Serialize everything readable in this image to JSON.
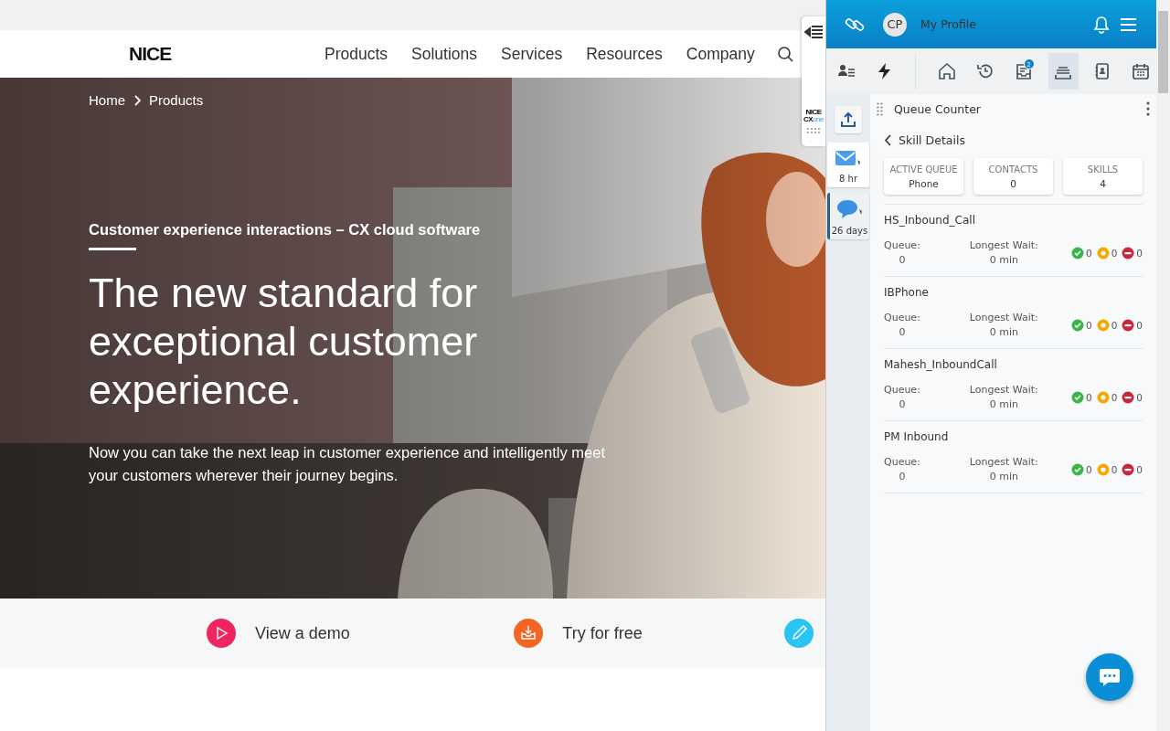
{
  "site": {
    "logo": "NICE",
    "nav": [
      "Products",
      "Solutions",
      "Services",
      "Resources",
      "Company"
    ],
    "breadcrumb": [
      "Home",
      "Products"
    ],
    "hero": {
      "eyebrow": "Customer experience interactions – CX cloud software",
      "title": "The new standard for exceptional customer experience.",
      "body": "Now you can take the next leap in customer experience and intelligently meet your customers wherever their journey begins."
    },
    "actions": [
      {
        "kind": "play",
        "label": "View a demo",
        "color": "#f0245e"
      },
      {
        "kind": "download",
        "label": "Try for free",
        "color": "#f26522"
      },
      {
        "kind": "pencil",
        "color": "#27c4f4"
      }
    ]
  },
  "side_widget": {
    "logo_top": "NICE",
    "logo_bottom": "CX",
    "logo_suffix": "one"
  },
  "agent": {
    "avatar": "CP",
    "profile": "My Profile",
    "toolbar": [
      {
        "kind": "contacts",
        "selected": false
      },
      {
        "kind": "bolt",
        "selected": false
      },
      {
        "kind": "home",
        "selected": false
      },
      {
        "kind": "history",
        "selected": false
      },
      {
        "kind": "inbox",
        "selected": false,
        "badge": "2"
      },
      {
        "kind": "queue",
        "selected": true
      },
      {
        "kind": "directory",
        "selected": false
      },
      {
        "kind": "calendar",
        "selected": false
      }
    ],
    "rail": [
      {
        "kind": "upload",
        "selected": false
      },
      {
        "kind": "email",
        "time": "8 hr",
        "selected": false
      },
      {
        "kind": "chat",
        "time": "26 days",
        "selected": true
      }
    ],
    "widget_title": "Queue Counter",
    "back": "Skill Details",
    "summary": [
      {
        "label": "ACTIVE QUEUE",
        "value": "Phone"
      },
      {
        "label": "CONTACTS",
        "value": "0"
      },
      {
        "label": "SKILLS",
        "value": "4"
      }
    ],
    "skills": [
      {
        "name": "HS_Inbound_Call",
        "queue_label": "Queue:",
        "queue": "0",
        "wait_label": "Longest Wait:",
        "wait": "0 min",
        "counts": [
          {
            "kind": "available",
            "color": "#3bb54a",
            "value": "0"
          },
          {
            "kind": "pending",
            "color": "#f7a700",
            "value": "0"
          },
          {
            "kind": "blocked",
            "color": "#c8283c",
            "value": "0"
          }
        ]
      },
      {
        "name": "IBPhone",
        "queue_label": "Queue:",
        "queue": "0",
        "wait_label": "Longest Wait:",
        "wait": "0 min",
        "counts": [
          {
            "kind": "available",
            "color": "#3bb54a",
            "value": "0"
          },
          {
            "kind": "pending",
            "color": "#f7a700",
            "value": "0"
          },
          {
            "kind": "blocked",
            "color": "#c8283c",
            "value": "0"
          }
        ]
      },
      {
        "name": "Mahesh_InboundCall",
        "queue_label": "Queue:",
        "queue": "0",
        "wait_label": "Longest Wait:",
        "wait": "0 min",
        "counts": [
          {
            "kind": "available",
            "color": "#3bb54a",
            "value": "0"
          },
          {
            "kind": "pending",
            "color": "#f7a700",
            "value": "0"
          },
          {
            "kind": "blocked",
            "color": "#c8283c",
            "value": "0"
          }
        ]
      },
      {
        "name": "PM Inbound",
        "queue_label": "Queue:",
        "queue": "0",
        "wait_label": "Longest Wait:",
        "wait": "0 min",
        "counts": [
          {
            "kind": "available",
            "color": "#3bb54a",
            "value": "0"
          },
          {
            "kind": "pending",
            "color": "#f7a700",
            "value": "0"
          },
          {
            "kind": "blocked",
            "color": "#c8283c",
            "value": "0"
          }
        ]
      }
    ]
  }
}
